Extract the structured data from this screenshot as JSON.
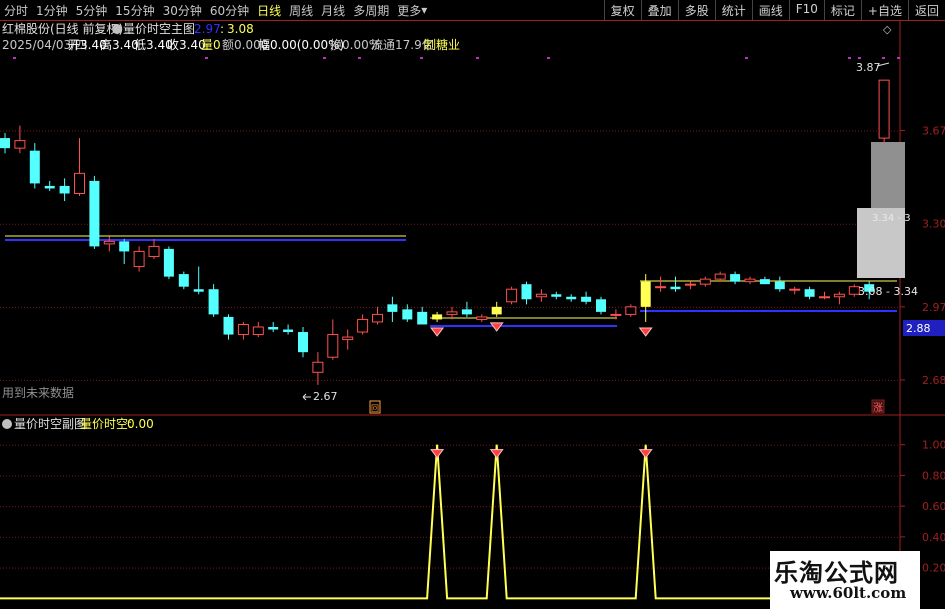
{
  "toolbar": {
    "periods": [
      "分时",
      "1分钟",
      "5分钟",
      "15分钟",
      "30分钟",
      "60分钟",
      "日线",
      "周线",
      "月线",
      "多周期",
      "更多"
    ],
    "active_period": "日线",
    "more_arrow": "▾",
    "buttons": [
      "复权",
      "叠加",
      "多股",
      "统计",
      "画线",
      "F10",
      "标记",
      "+自选",
      "返回"
    ]
  },
  "main_panel": {
    "stock_name": "红棉股份(日线 前复权)",
    "indicator_name": "量价时空主图",
    "indicator_value_1": "2.97",
    "indicator_sep": ":",
    "indicator_value_2": "3.08",
    "info_date": "2025/04/03/四",
    "info_open": "开3.40",
    "info_high": "高3.40",
    "info_low": "低3.40",
    "info_close": "收3.40",
    "info_vol": "量0",
    "info_amount": "额0.000",
    "info_amp": "幅0.00(0.00%)",
    "info_turnover": "换0.00%",
    "info_float": "流通17.9亿",
    "info_industry": "制糖业",
    "future_data_note": "用到未来数据",
    "low_marker": "2.67",
    "high_marker": "3.87",
    "zone_label": "3.34 - 3",
    "range_label": "3.08 - 3.34",
    "price_tag": "2.88",
    "small_box_glyph": "回",
    "rise_glyph": "涨",
    "top_right_glyph": "◇"
  },
  "sub_panel": {
    "indicator_name": "量价时空副图",
    "label": "量价时空:",
    "value": "0.00"
  },
  "watermark": {
    "line1": "乐淘公式网",
    "line2": "www.60lt.com"
  },
  "colors": {
    "up": "#ff5050",
    "down": "#54ffff",
    "axis": "#a02020",
    "yellow": "#ffff54",
    "blue": "#3030ff"
  },
  "chart_data": [
    {
      "type": "candlestick",
      "title": "量价时空主图",
      "y_ticks": [
        2.68,
        2.97,
        3.3,
        3.67
      ],
      "ylim": [
        2.62,
        3.95
      ],
      "candles": [
        {
          "o": 3.64,
          "h": 3.66,
          "l": 3.58,
          "c": 3.6
        },
        {
          "o": 3.6,
          "h": 3.69,
          "l": 3.58,
          "c": 3.63
        },
        {
          "o": 3.59,
          "h": 3.62,
          "l": 3.44,
          "c": 3.46
        },
        {
          "o": 3.45,
          "h": 3.47,
          "l": 3.43,
          "c": 3.44
        },
        {
          "o": 3.45,
          "h": 3.48,
          "l": 3.39,
          "c": 3.42
        },
        {
          "o": 3.42,
          "h": 3.64,
          "l": 3.41,
          "c": 3.5
        },
        {
          "o": 3.47,
          "h": 3.49,
          "l": 3.2,
          "c": 3.21
        },
        {
          "o": 3.22,
          "h": 3.25,
          "l": 3.19,
          "c": 3.23
        },
        {
          "o": 3.23,
          "h": 3.24,
          "l": 3.14,
          "c": 3.19
        },
        {
          "o": 3.13,
          "h": 3.21,
          "l": 3.11,
          "c": 3.19
        },
        {
          "o": 3.17,
          "h": 3.24,
          "l": 3.16,
          "c": 3.21
        },
        {
          "o": 3.2,
          "h": 3.21,
          "l": 3.08,
          "c": 3.09
        },
        {
          "o": 3.1,
          "h": 3.11,
          "l": 3.04,
          "c": 3.05
        },
        {
          "o": 3.04,
          "h": 3.13,
          "l": 3.02,
          "c": 3.03
        },
        {
          "o": 3.04,
          "h": 3.06,
          "l": 2.93,
          "c": 2.94
        },
        {
          "o": 2.93,
          "h": 2.94,
          "l": 2.84,
          "c": 2.86
        },
        {
          "o": 2.86,
          "h": 2.91,
          "l": 2.84,
          "c": 2.9
        },
        {
          "o": 2.86,
          "h": 2.91,
          "l": 2.85,
          "c": 2.89
        },
        {
          "o": 2.89,
          "h": 2.91,
          "l": 2.87,
          "c": 2.88
        },
        {
          "o": 2.88,
          "h": 2.9,
          "l": 2.86,
          "c": 2.87
        },
        {
          "o": 2.87,
          "h": 2.89,
          "l": 2.77,
          "c": 2.79
        },
        {
          "o": 2.71,
          "h": 2.79,
          "l": 2.66,
          "c": 2.75
        },
        {
          "o": 2.77,
          "h": 2.92,
          "l": 2.76,
          "c": 2.86
        },
        {
          "o": 2.84,
          "h": 2.88,
          "l": 2.8,
          "c": 2.85
        },
        {
          "o": 2.87,
          "h": 2.94,
          "l": 2.86,
          "c": 2.92
        },
        {
          "o": 2.91,
          "h": 2.97,
          "l": 2.9,
          "c": 2.94
        },
        {
          "o": 2.98,
          "h": 3.01,
          "l": 2.91,
          "c": 2.95
        },
        {
          "o": 2.96,
          "h": 2.98,
          "l": 2.91,
          "c": 2.92
        },
        {
          "o": 2.95,
          "h": 2.97,
          "l": 2.9,
          "c": 2.9
        },
        {
          "o": 2.92,
          "h": 2.95,
          "l": 2.91,
          "c": 2.94
        },
        {
          "o": 2.94,
          "h": 2.97,
          "l": 2.92,
          "c": 2.95
        },
        {
          "o": 2.96,
          "h": 2.99,
          "l": 2.93,
          "c": 2.94
        },
        {
          "o": 2.92,
          "h": 2.94,
          "l": 2.91,
          "c": 2.93
        },
        {
          "o": 2.94,
          "h": 2.99,
          "l": 2.93,
          "c": 2.97
        },
        {
          "o": 2.99,
          "h": 3.05,
          "l": 2.98,
          "c": 3.04
        },
        {
          "o": 3.06,
          "h": 3.07,
          "l": 2.98,
          "c": 3.0
        },
        {
          "o": 3.01,
          "h": 3.04,
          "l": 2.99,
          "c": 3.02
        },
        {
          "o": 3.02,
          "h": 3.03,
          "l": 3.0,
          "c": 3.01
        },
        {
          "o": 3.01,
          "h": 3.02,
          "l": 2.99,
          "c": 3.0
        },
        {
          "o": 3.01,
          "h": 3.03,
          "l": 2.98,
          "c": 2.99
        },
        {
          "o": 3.0,
          "h": 3.01,
          "l": 2.94,
          "c": 2.95
        },
        {
          "o": 2.94,
          "h": 2.96,
          "l": 2.92,
          "c": 2.94
        },
        {
          "o": 2.94,
          "h": 2.98,
          "l": 2.93,
          "c": 2.97
        },
        {
          "o": 2.97,
          "h": 3.1,
          "l": 2.91,
          "c": 3.07
        },
        {
          "o": 3.05,
          "h": 3.09,
          "l": 3.03,
          "c": 3.05
        },
        {
          "o": 3.05,
          "h": 3.09,
          "l": 3.03,
          "c": 3.04
        },
        {
          "o": 3.06,
          "h": 3.07,
          "l": 3.04,
          "c": 3.06
        },
        {
          "o": 3.06,
          "h": 3.09,
          "l": 3.05,
          "c": 3.08
        },
        {
          "o": 3.08,
          "h": 3.11,
          "l": 3.07,
          "c": 3.1
        },
        {
          "o": 3.1,
          "h": 3.11,
          "l": 3.06,
          "c": 3.07
        },
        {
          "o": 3.07,
          "h": 3.09,
          "l": 3.06,
          "c": 3.08
        },
        {
          "o": 3.08,
          "h": 3.09,
          "l": 3.06,
          "c": 3.06
        },
        {
          "o": 3.07,
          "h": 3.09,
          "l": 3.03,
          "c": 3.04
        },
        {
          "o": 3.04,
          "h": 3.05,
          "l": 3.02,
          "c": 3.04
        },
        {
          "o": 3.04,
          "h": 3.05,
          "l": 3.0,
          "c": 3.01
        },
        {
          "o": 3.01,
          "h": 3.03,
          "l": 3.0,
          "c": 3.01
        },
        {
          "o": 3.01,
          "h": 3.03,
          "l": 2.98,
          "c": 3.02
        },
        {
          "o": 3.02,
          "h": 3.06,
          "l": 3.01,
          "c": 3.05
        },
        {
          "o": 3.06,
          "h": 3.07,
          "l": 3.0,
          "c": 3.03
        },
        {
          "o": 3.64,
          "h": 3.87,
          "l": 3.62,
          "c": 3.87
        }
      ]
    },
    {
      "type": "line",
      "title": "量价时空副图",
      "series": [
        {
          "name": "量价时空",
          "values": [
            0,
            0,
            0,
            0,
            0,
            0,
            0,
            0,
            0,
            0,
            0,
            0,
            0,
            0,
            0,
            0,
            0,
            0,
            0,
            0,
            0,
            0,
            0,
            0,
            0,
            0,
            0,
            0,
            0,
            1,
            0,
            0,
            0,
            1,
            0,
            0,
            0,
            0,
            0,
            0,
            0,
            0,
            0,
            1,
            0,
            0,
            0,
            0,
            0,
            0,
            0,
            0,
            0,
            0,
            0,
            0,
            0,
            0,
            0,
            0
          ]
        }
      ],
      "y_ticks": [
        0.2,
        0.4,
        0.6,
        0.8,
        1.0
      ],
      "ylim": [
        -0.05,
        1.05
      ]
    }
  ]
}
